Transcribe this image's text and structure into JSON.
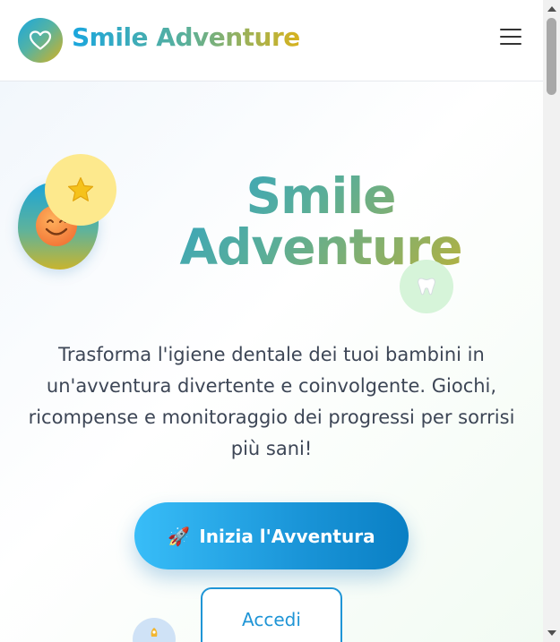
{
  "header": {
    "brand": "Smile Adventure",
    "logo_icon": "heart-icon",
    "menu_icon": "hamburger-menu-icon"
  },
  "hero": {
    "title_line1": "Smile",
    "title_line2": "Adventure",
    "description": "Trasforma l'igiene dentale dei tuoi bambini in un'avventura divertente e coinvolgente. Giochi, ricompense e monitoraggio dei progressi per sorrisi più sani!",
    "cta_label": "Inizia l'Avventura",
    "cta_icon": "🚀",
    "login_label": "Accedi",
    "decorations": {
      "smile_icon": "smiling-face-icon",
      "star_icon": "⭐",
      "tooth_icon": "🦷",
      "rocket_icon": "rocket-icon"
    }
  },
  "colors": {
    "brand_blue": "#1aa6de",
    "brand_green": "#5ab09a",
    "brand_gold": "#d8b21c",
    "cta_blue": "#1a95d8",
    "text_dark": "#3d4656"
  }
}
